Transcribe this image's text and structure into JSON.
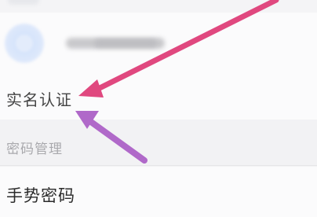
{
  "settings": {
    "realname_label": "实名认证",
    "password_section_label": "密码管理",
    "gesture_password_label": "手势密码"
  },
  "annotations": {
    "pink_arrow_color": "#e0487f",
    "purple_arrow_color": "#b069c9"
  }
}
